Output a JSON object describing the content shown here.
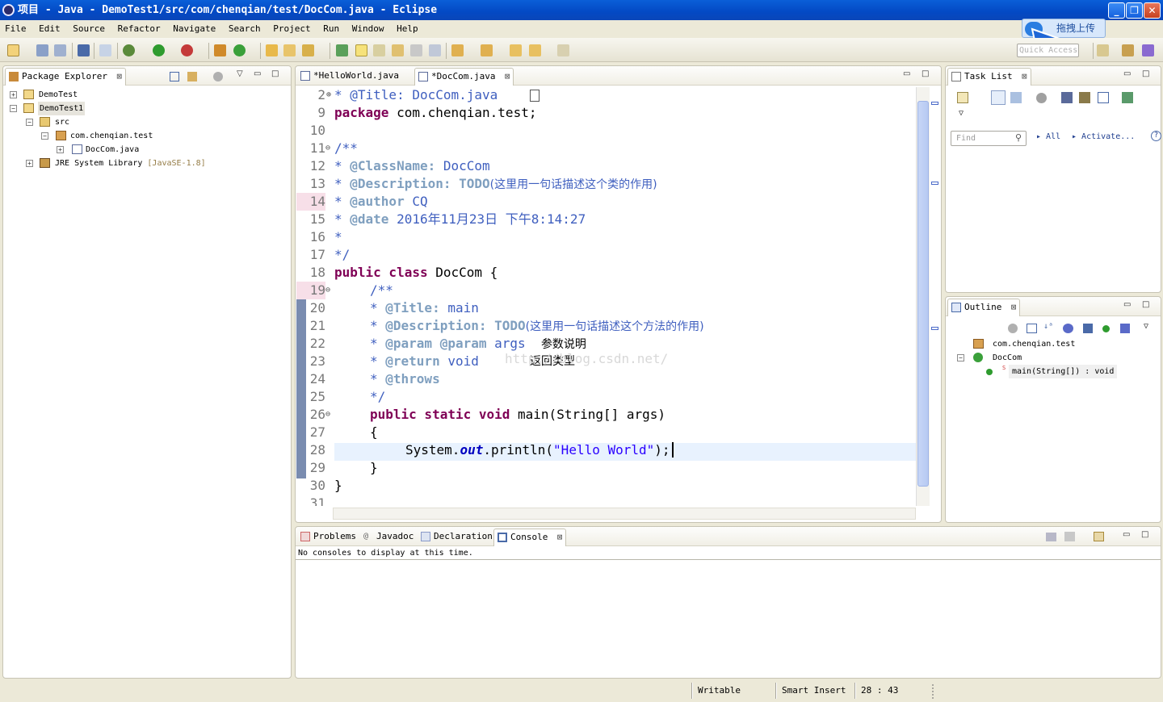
{
  "window": {
    "title": "项目 - Java - DemoTest1/src/com/chenqian/test/DocCom.java - Eclipse"
  },
  "menu": [
    "File",
    "Edit",
    "Source",
    "Refactor",
    "Navigate",
    "Search",
    "Project",
    "Run",
    "Window",
    "Help"
  ],
  "overlay": {
    "upload_label": "拖拽上传",
    "quick_access": "Quick Access"
  },
  "package_explorer": {
    "tab_label": "Package Explorer",
    "tree": [
      {
        "label": "DemoTest",
        "level": 0,
        "expander": "+"
      },
      {
        "label": "DemoTest1",
        "level": 0,
        "expander": "−",
        "selected": true
      },
      {
        "label": "src",
        "level": 1,
        "expander": "−"
      },
      {
        "label": "com.chenqian.test",
        "level": 2,
        "expander": "−"
      },
      {
        "label": "DocCom.java",
        "level": 3,
        "expander": "+"
      },
      {
        "label": "JRE System Library",
        "level": 1,
        "expander": "+",
        "extra": "[JavaSE-1.8]"
      }
    ]
  },
  "editor": {
    "tabs": [
      {
        "label": "*HelloWorld.java",
        "active": false
      },
      {
        "label": "*DocCom.java",
        "active": true
      }
    ]
  },
  "code_lines": [
    {
      "n": "2",
      "marker": "⊕"
    },
    {
      "n": "9"
    },
    {
      "n": "10"
    },
    {
      "n": "11",
      "marker": "⊖"
    },
    {
      "n": "12"
    },
    {
      "n": "13"
    },
    {
      "n": "14",
      "highlight": true
    },
    {
      "n": "15"
    },
    {
      "n": "16"
    },
    {
      "n": "17"
    },
    {
      "n": "18"
    },
    {
      "n": "19",
      "marker": "⊖"
    },
    {
      "n": "20"
    },
    {
      "n": "21"
    },
    {
      "n": "22"
    },
    {
      "n": "23"
    },
    {
      "n": "24"
    },
    {
      "n": "25"
    },
    {
      "n": "26",
      "marker": "⊖"
    },
    {
      "n": "27"
    },
    {
      "n": "28",
      "current": true
    },
    {
      "n": "29"
    },
    {
      "n": "30"
    },
    {
      "n": "31"
    }
  ],
  "code": {
    "l2": "* @Title: DocCom.java",
    "l9_kw": "package",
    "l9_rest": " com.chenqian.test;",
    "l11": "/**",
    "l12_tag": "@ClassName:",
    "l12_rest": " DocCom",
    "l13_tag": "@Description:",
    "l13_todo": " TODO",
    "l13_cjk": "(这里用一句话描述这个类的作用)",
    "l14_tag": "@author",
    "l14_rest": " CQ",
    "l15_tag": "@date",
    "l15_rest": " 2016年11月23日 下午8:14:27",
    "l16": "*",
    "l17": "*/",
    "l18_kw": "public class",
    "l18_rest": " DocCom {",
    "l19": "/**",
    "l20_tag": "@Title:",
    "l20_rest": " main",
    "l21_tag": "@Description:",
    "l21_todo": " TODO",
    "l21_cjk": "(这里用一句话描述这个方法的作用)",
    "l22_tag": "@param",
    "l22_tag2": "@param",
    "l22_rest": " args",
    "l22_cjk": "参数说明",
    "l23_tag": "@return",
    "l23_rest": " void",
    "l23_cjk": "返回类型",
    "l24_tag": "@throws",
    "l25": "*/",
    "l26_kw": "public static void",
    "l26_rest": " main(String[] args)",
    "l27": "{",
    "l28_a": "System.",
    "l28_fld": "out",
    "l28_b": ".println(",
    "l28_str": "\"Hello World\"",
    "l28_c": ");",
    "l29": "}",
    "l30": "}",
    "watermark": "http://blog.csdn.net/"
  },
  "task_list": {
    "tab_label": "Task List",
    "find_placeholder": "Find",
    "all_label": "All",
    "activate_label": "Activate..."
  },
  "outline": {
    "tab_label": "Outline",
    "tree": [
      {
        "label": "com.chenqian.test"
      },
      {
        "label": "DocCom"
      },
      {
        "label": "main(String[]) : void"
      }
    ]
  },
  "bottom": {
    "tabs": [
      {
        "label": "Problems",
        "active": false
      },
      {
        "label": "Javadoc",
        "active": false
      },
      {
        "label": "Declaration",
        "active": false
      },
      {
        "label": "Console",
        "active": true
      }
    ],
    "console_message": "No consoles to display at this time."
  },
  "status": {
    "writable": "Writable",
    "insert_mode": "Smart Insert",
    "position": "28 : 43"
  },
  "colors": {
    "keyword": "#7f0055",
    "javadoc": "#3f5fbf",
    "javadoc_tag": "#7f9fbf",
    "string": "#2a00ff",
    "field": "#0000c0",
    "titlebar": "#0a5fd8"
  }
}
